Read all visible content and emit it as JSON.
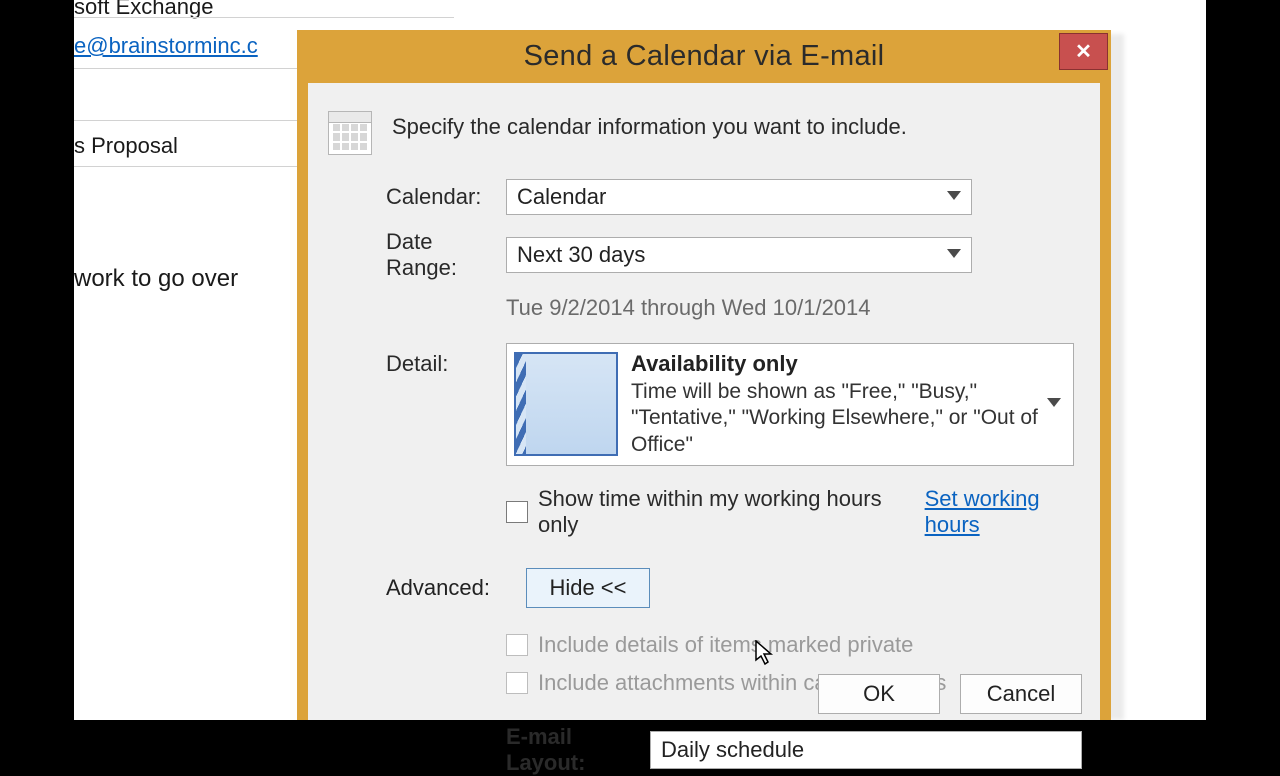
{
  "background": {
    "header_text": "soft Exchange",
    "email_link": "e@brainstorminc.c",
    "subject_fragment": "s Proposal",
    "body_fragment": "work to go over"
  },
  "dialog": {
    "title": "Send a Calendar via E-mail",
    "intro": "Specify the calendar information you want to include.",
    "calendar_label": "Calendar:",
    "calendar_value": "Calendar",
    "daterange_label": "Date Range:",
    "daterange_value": "Next 30 days",
    "daterange_note": "Tue 9/2/2014 through Wed 10/1/2014",
    "detail_label": "Detail:",
    "detail_title": "Availability only",
    "detail_desc": "Time will be shown as \"Free,\" \"Busy,\" \"Tentative,\" \"Working Elsewhere,\" or \"Out of Office\"",
    "working_hours_check": "Show time within my working hours only",
    "set_working_hours": "Set working hours",
    "advanced_label": "Advanced:",
    "hide_btn": "Hide <<",
    "private_check": "Include details of items marked private",
    "attach_check": "Include attachments within calendar items",
    "layout_label": "E-mail Layout:",
    "layout_value": "Daily schedule",
    "ok": "OK",
    "cancel": "Cancel"
  }
}
